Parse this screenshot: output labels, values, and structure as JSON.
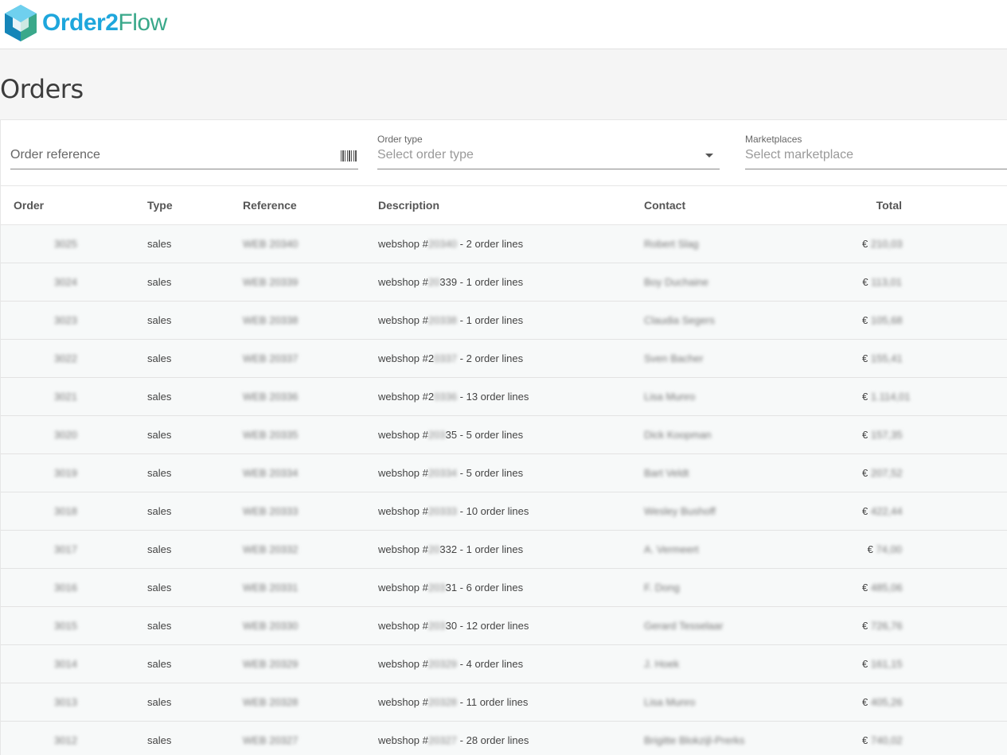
{
  "brand": {
    "order": "Order2",
    "flow": "Flow"
  },
  "page": {
    "title": "Orders"
  },
  "filters": {
    "reference": {
      "placeholder": "Order reference"
    },
    "order_type": {
      "label": "Order type",
      "placeholder": "Select order type"
    },
    "marketplaces": {
      "label": "Marketplaces",
      "placeholder": "Select marketplace"
    }
  },
  "table": {
    "headers": {
      "order": "Order",
      "type": "Type",
      "reference": "Reference",
      "description": "Description",
      "contact": "Contact",
      "total": "Total"
    },
    "rows": [
      {
        "order": "3025",
        "type": "sales",
        "reference": "WEB 20340",
        "desc_prefix": "webshop #",
        "desc_hidden": "20340",
        "desc_suffix": " - 2 order lines",
        "contact": "Robert Slag",
        "currency": "€",
        "total": "210,03"
      },
      {
        "order": "3024",
        "type": "sales",
        "reference": "WEB 20339",
        "desc_prefix": "webshop #",
        "desc_hidden": "20",
        "desc_suffix": "339 - 1 order lines",
        "contact": "Boy Duchaine",
        "currency": "€",
        "total": "113,01"
      },
      {
        "order": "3023",
        "type": "sales",
        "reference": "WEB 20338",
        "desc_prefix": "webshop #",
        "desc_hidden": "20338",
        "desc_suffix": " - 1 order lines",
        "contact": "Claudia Segers",
        "currency": "€",
        "total": "105,68"
      },
      {
        "order": "3022",
        "type": "sales",
        "reference": "WEB 20337",
        "desc_prefix": "webshop #2",
        "desc_hidden": "0337",
        "desc_suffix": " - 2 order lines",
        "contact": "Sven Bacher",
        "currency": "€",
        "total": "155,41"
      },
      {
        "order": "3021",
        "type": "sales",
        "reference": "WEB 20336",
        "desc_prefix": "webshop #2",
        "desc_hidden": "0336",
        "desc_suffix": " - 13 order lines",
        "contact": "Lisa Munro",
        "currency": "€",
        "total": "1.114,01"
      },
      {
        "order": "3020",
        "type": "sales",
        "reference": "WEB 20335",
        "desc_prefix": "webshop #",
        "desc_hidden": "203",
        "desc_suffix": "35 - 5 order lines",
        "contact": "Dick Koopman",
        "currency": "€",
        "total": "157,35"
      },
      {
        "order": "3019",
        "type": "sales",
        "reference": "WEB 20334",
        "desc_prefix": "webshop #",
        "desc_hidden": "20334",
        "desc_suffix": " - 5 order lines",
        "contact": "Bart Veldt",
        "currency": "€",
        "total": "207,52"
      },
      {
        "order": "3018",
        "type": "sales",
        "reference": "WEB 20333",
        "desc_prefix": "webshop #",
        "desc_hidden": "20333",
        "desc_suffix": " - 10 order lines",
        "contact": "Wesley Bushoff",
        "currency": "€",
        "total": "422,44"
      },
      {
        "order": "3017",
        "type": "sales",
        "reference": "WEB 20332",
        "desc_prefix": "webshop #",
        "desc_hidden": "20",
        "desc_suffix": "332 - 1 order lines",
        "contact": "A. Vermeert",
        "currency": "€",
        "total": "74,00"
      },
      {
        "order": "3016",
        "type": "sales",
        "reference": "WEB 20331",
        "desc_prefix": "webshop #",
        "desc_hidden": "203",
        "desc_suffix": "31 - 6 order lines",
        "contact": "F. Dong",
        "currency": "€",
        "total": "485,06"
      },
      {
        "order": "3015",
        "type": "sales",
        "reference": "WEB 20330",
        "desc_prefix": "webshop #",
        "desc_hidden": "203",
        "desc_suffix": "30 - 12 order lines",
        "contact": "Gerard Tesselaar",
        "currency": "€",
        "total": "726,76"
      },
      {
        "order": "3014",
        "type": "sales",
        "reference": "WEB 20329",
        "desc_prefix": "webshop #",
        "desc_hidden": "20329",
        "desc_suffix": " - 4 order lines",
        "contact": "J. Hoek",
        "currency": "€",
        "total": "161,15"
      },
      {
        "order": "3013",
        "type": "sales",
        "reference": "WEB 20328",
        "desc_prefix": "webshop #",
        "desc_hidden": "20328",
        "desc_suffix": " - 11 order lines",
        "contact": "Lisa Munro",
        "currency": "€",
        "total": "405,26"
      },
      {
        "order": "3012",
        "type": "sales",
        "reference": "WEB 20327",
        "desc_prefix": "webshop #",
        "desc_hidden": "20327",
        "desc_suffix": " - 28 order lines",
        "contact": "Brigitte Blokzijl-Prerks",
        "currency": "€",
        "total": "740,02"
      }
    ]
  }
}
